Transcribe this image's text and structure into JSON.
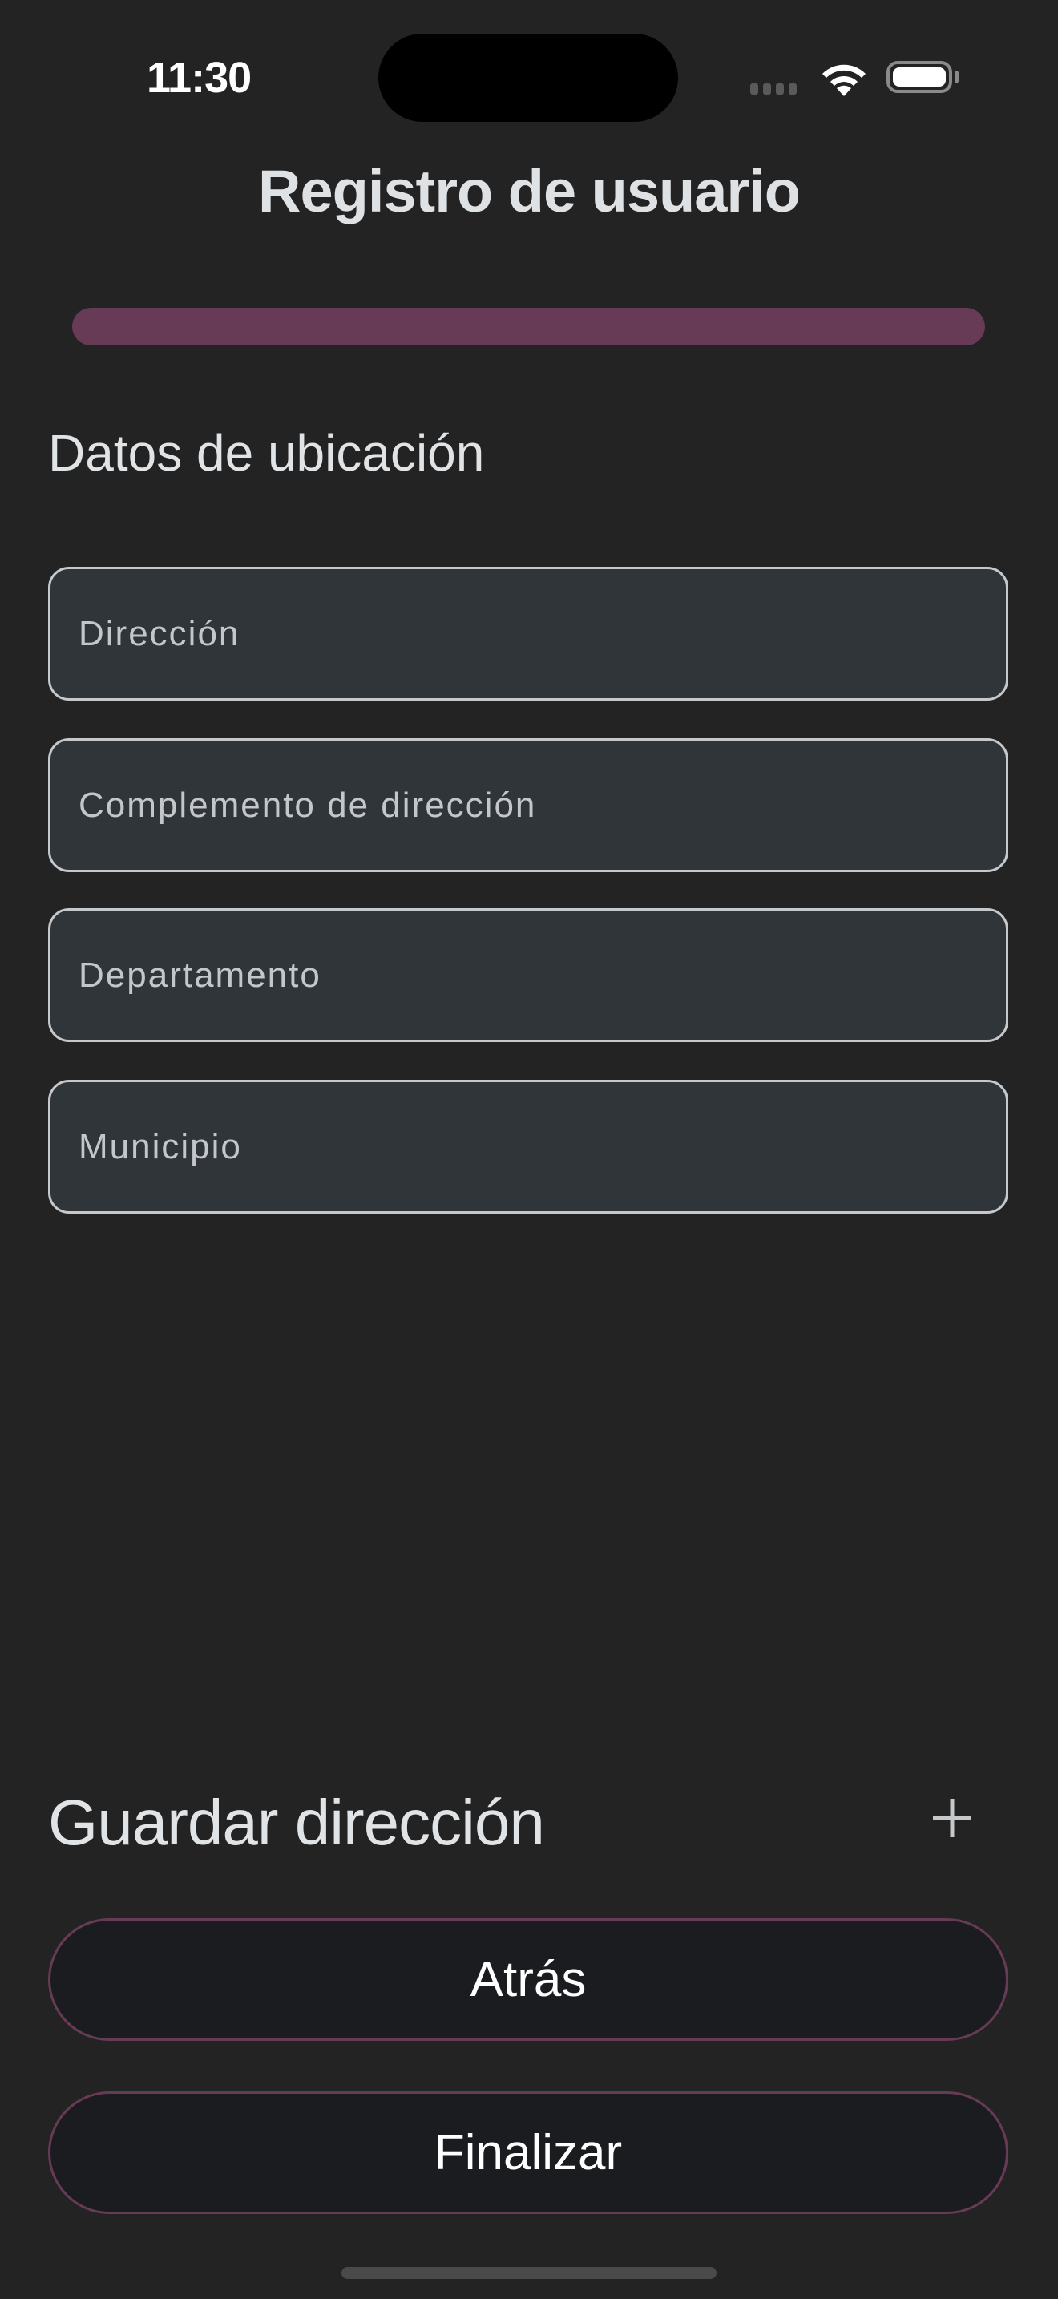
{
  "status_bar": {
    "time": "11:30",
    "icons": [
      "cellular-signal-icon",
      "wifi-icon",
      "battery-icon"
    ]
  },
  "header": {
    "title": "Registro de usuario"
  },
  "progress": {
    "value_percent": 100,
    "color": "#673a56"
  },
  "section": {
    "title": "Datos de ubicación"
  },
  "fields": [
    {
      "placeholder": "Dirección",
      "value": ""
    },
    {
      "placeholder": "Complemento de dirección",
      "value": ""
    },
    {
      "placeholder": "Departamento",
      "value": ""
    },
    {
      "placeholder": "Municipio",
      "value": ""
    }
  ],
  "save_address": {
    "label": "Guardar dirección",
    "icon": "plus-icon"
  },
  "buttons": {
    "back": "Atrás",
    "finish": "Finalizar"
  },
  "colors": {
    "background": "#232323",
    "accent": "#673a56",
    "button_bg": "#1b1c20",
    "field_bg": "#30353a"
  }
}
